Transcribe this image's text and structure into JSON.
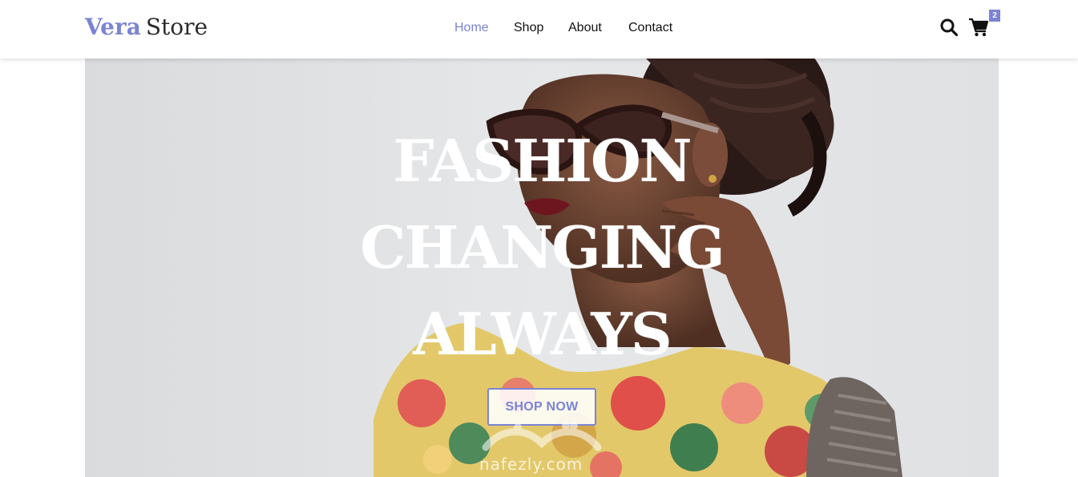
{
  "brand": {
    "name_accent": "Vera",
    "name_rest": "Store",
    "accent_color": "#7b84d4"
  },
  "nav": {
    "items": [
      {
        "label": "Home",
        "active": true
      },
      {
        "label": "Shop",
        "active": false
      },
      {
        "label": "About",
        "active": false
      },
      {
        "label": "Contact",
        "active": false
      }
    ]
  },
  "header_icons": {
    "search": "search-icon",
    "cart": "cart-icon",
    "cart_count": "2"
  },
  "hero": {
    "title_lines": [
      "FASHION",
      "CHANGING",
      "ALWAYS"
    ],
    "cta_label": "SHOP NOW",
    "watermark": "nafezly.com"
  }
}
